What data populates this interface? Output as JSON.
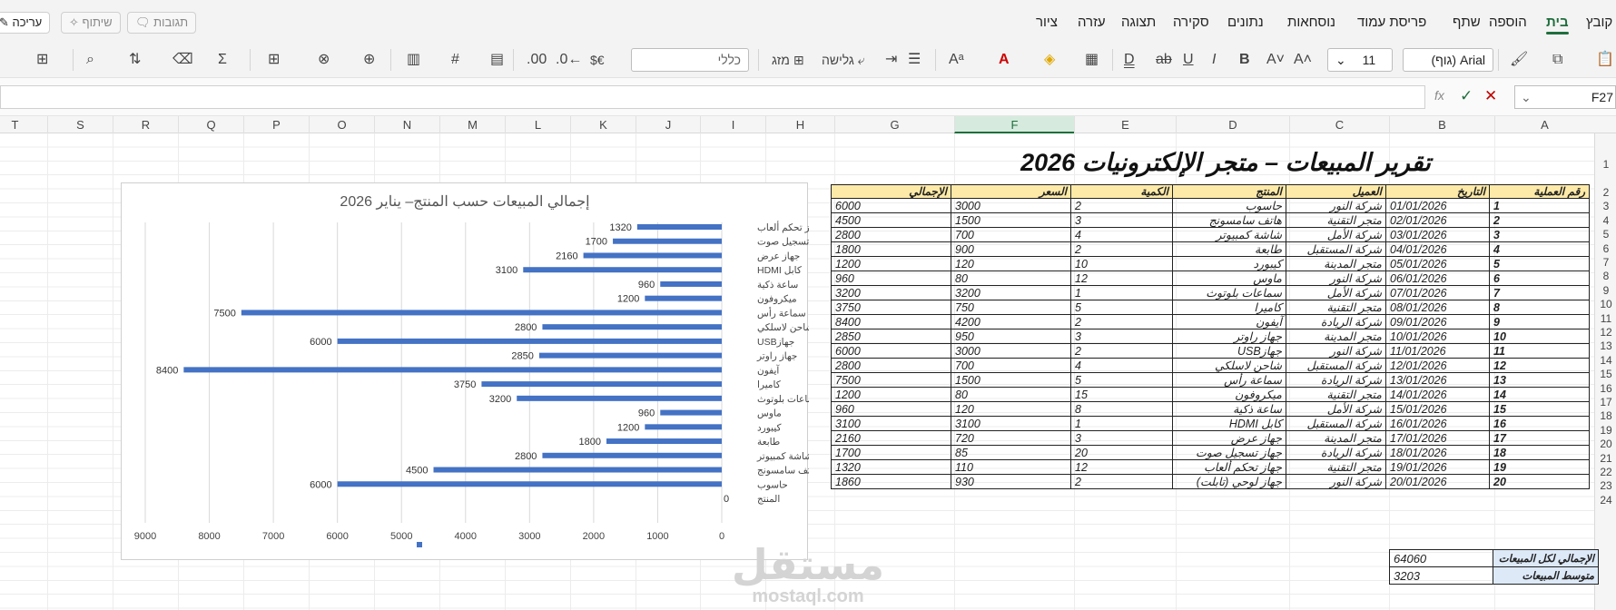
{
  "app": {
    "tabs": [
      "קובץ",
      "בית",
      "הוספה",
      "שתף",
      "פריסת עמוד",
      "נוסחאות",
      "נתונים",
      "סקירה",
      "תצוגה",
      "עזרה",
      "ציור"
    ],
    "active_tab": "בית",
    "buttons": {
      "edit": "עריכה",
      "comments": "תגובות",
      "share": "שיתוף"
    },
    "accent": "#1e6e3c"
  },
  "ribbon": {
    "font_name": "Arial (גוף)",
    "font_size": "11",
    "number_format": "כללי",
    "wrap_text": "גלישה",
    "merge": "מזג",
    "currency": "$€"
  },
  "formula_bar": {
    "cell_ref": "F27",
    "formula": ""
  },
  "columns": [
    "A",
    "B",
    "C",
    "D",
    "E",
    "F",
    "G",
    "H",
    "I",
    "J",
    "K",
    "L",
    "M",
    "N",
    "O",
    "P",
    "Q",
    "R",
    "S",
    "T"
  ],
  "selected_column": "F",
  "rows": [
    "1",
    "2",
    "3",
    "4",
    "5",
    "6",
    "7",
    "8",
    "9",
    "10",
    "11",
    "12",
    "13",
    "14",
    "15",
    "16",
    "17",
    "18",
    "19",
    "20",
    "21",
    "22",
    "23",
    "24"
  ],
  "sheet": {
    "title": "تقرير المبيعات – متجر الإلكترونيات 2026",
    "headers": [
      "رقم العملية",
      "التاريخ",
      "العميل",
      "المنتج",
      "الكمية",
      "السعر",
      "الإجمالي"
    ],
    "rows": [
      [
        "1",
        "01/01/2026",
        "شركة النور",
        "حاسوب",
        "2",
        "3000",
        "6000"
      ],
      [
        "2",
        "02/01/2026",
        "متجر التقنية",
        "هاتف سامسونج",
        "3",
        "1500",
        "4500"
      ],
      [
        "3",
        "03/01/2026",
        "شركة الأمل",
        "شاشة كمبيوتر",
        "4",
        "700",
        "2800"
      ],
      [
        "4",
        "04/01/2026",
        "شركة المستقبل",
        "طابعة",
        "2",
        "900",
        "1800"
      ],
      [
        "5",
        "05/01/2026",
        "متجر المدينة",
        "كيبورد",
        "10",
        "120",
        "1200"
      ],
      [
        "6",
        "06/01/2026",
        "شركة النور",
        "ماوس",
        "12",
        "80",
        "960"
      ],
      [
        "7",
        "07/01/2026",
        "شركة الأمل",
        "سماعات بلوتوث",
        "1",
        "3200",
        "3200"
      ],
      [
        "8",
        "08/01/2026",
        "متجر التقنية",
        "كاميرا",
        "5",
        "750",
        "3750"
      ],
      [
        "9",
        "09/01/2026",
        "شركة الريادة",
        "آيفون",
        "2",
        "4200",
        "8400"
      ],
      [
        "10",
        "10/01/2026",
        "متجر المدينة",
        "جهاز راوتر",
        "3",
        "950",
        "2850"
      ],
      [
        "11",
        "11/01/2026",
        "شركة النور",
        "جهازUSB",
        "2",
        "3000",
        "6000"
      ],
      [
        "12",
        "12/01/2026",
        "شركة المستقبل",
        "شاحن لاسلكي",
        "4",
        "700",
        "2800"
      ],
      [
        "13",
        "13/01/2026",
        "شركة الريادة",
        "سماعة رأس",
        "5",
        "1500",
        "7500"
      ],
      [
        "14",
        "14/01/2026",
        "متجر التقنية",
        "ميكروفون",
        "15",
        "80",
        "1200"
      ],
      [
        "15",
        "15/01/2026",
        "شركة الأمل",
        "ساعة ذكية",
        "8",
        "120",
        "960"
      ],
      [
        "16",
        "16/01/2026",
        "شركة المستقبل",
        "كابل HDMI",
        "1",
        "3100",
        "3100"
      ],
      [
        "17",
        "17/01/2026",
        "متجر المدينة",
        "جهاز عرض",
        "3",
        "720",
        "2160"
      ],
      [
        "18",
        "18/01/2026",
        "شركة الريادة",
        "جهاز تسجيل صوت",
        "20",
        "85",
        "1700"
      ],
      [
        "19",
        "19/01/2026",
        "متجر التقنية",
        "جهاز تحكم ألعاب",
        "12",
        "110",
        "1320"
      ],
      [
        "20",
        "20/01/2026",
        "شركة النور",
        "جهاز لوحي (تابلت)",
        "2",
        "930",
        "1860"
      ]
    ],
    "summary": [
      {
        "label": "الإجمالي لكل المبيعات",
        "value": "64060"
      },
      {
        "label": "متوسط المبيعات",
        "value": "3203"
      }
    ]
  },
  "chart_data": {
    "type": "bar",
    "orientation": "horizontal",
    "title": "إجمالي المبيعات حسب المنتج– يناير 2026",
    "categories": [
      "المنتج",
      "حاسوب",
      "هاتف سامسونج",
      "شاشة كمبيوتر",
      "طابعة",
      "كيبورد",
      "ماوس",
      "سماعات بلوتوث",
      "كاميرا",
      "آيفون",
      "جهاز راوتر",
      "جهازUSB",
      "شاحن لاسلكي",
      "سماعة رأس",
      "ميكروفون",
      "ساعة ذكية",
      "كابل HDMI",
      "جهاز عرض",
      "جهاز تسجيل صوت",
      "جهاز تحكم ألعاب"
    ],
    "values": [
      0,
      6000,
      4500,
      2800,
      1800,
      1200,
      960,
      3200,
      3750,
      8400,
      2850,
      6000,
      2800,
      7500,
      1200,
      960,
      3100,
      2160,
      1700,
      1320
    ],
    "xlim": [
      0,
      9000
    ],
    "xticks": [
      "0",
      "1000",
      "2000",
      "3000",
      "4000",
      "5000",
      "6000",
      "7000",
      "8000",
      "9000"
    ],
    "x_reversed": true,
    "grid": true,
    "bar_color": "#4472c4"
  },
  "watermark": {
    "text": "مستقل",
    "sub": "mostaql.com"
  }
}
